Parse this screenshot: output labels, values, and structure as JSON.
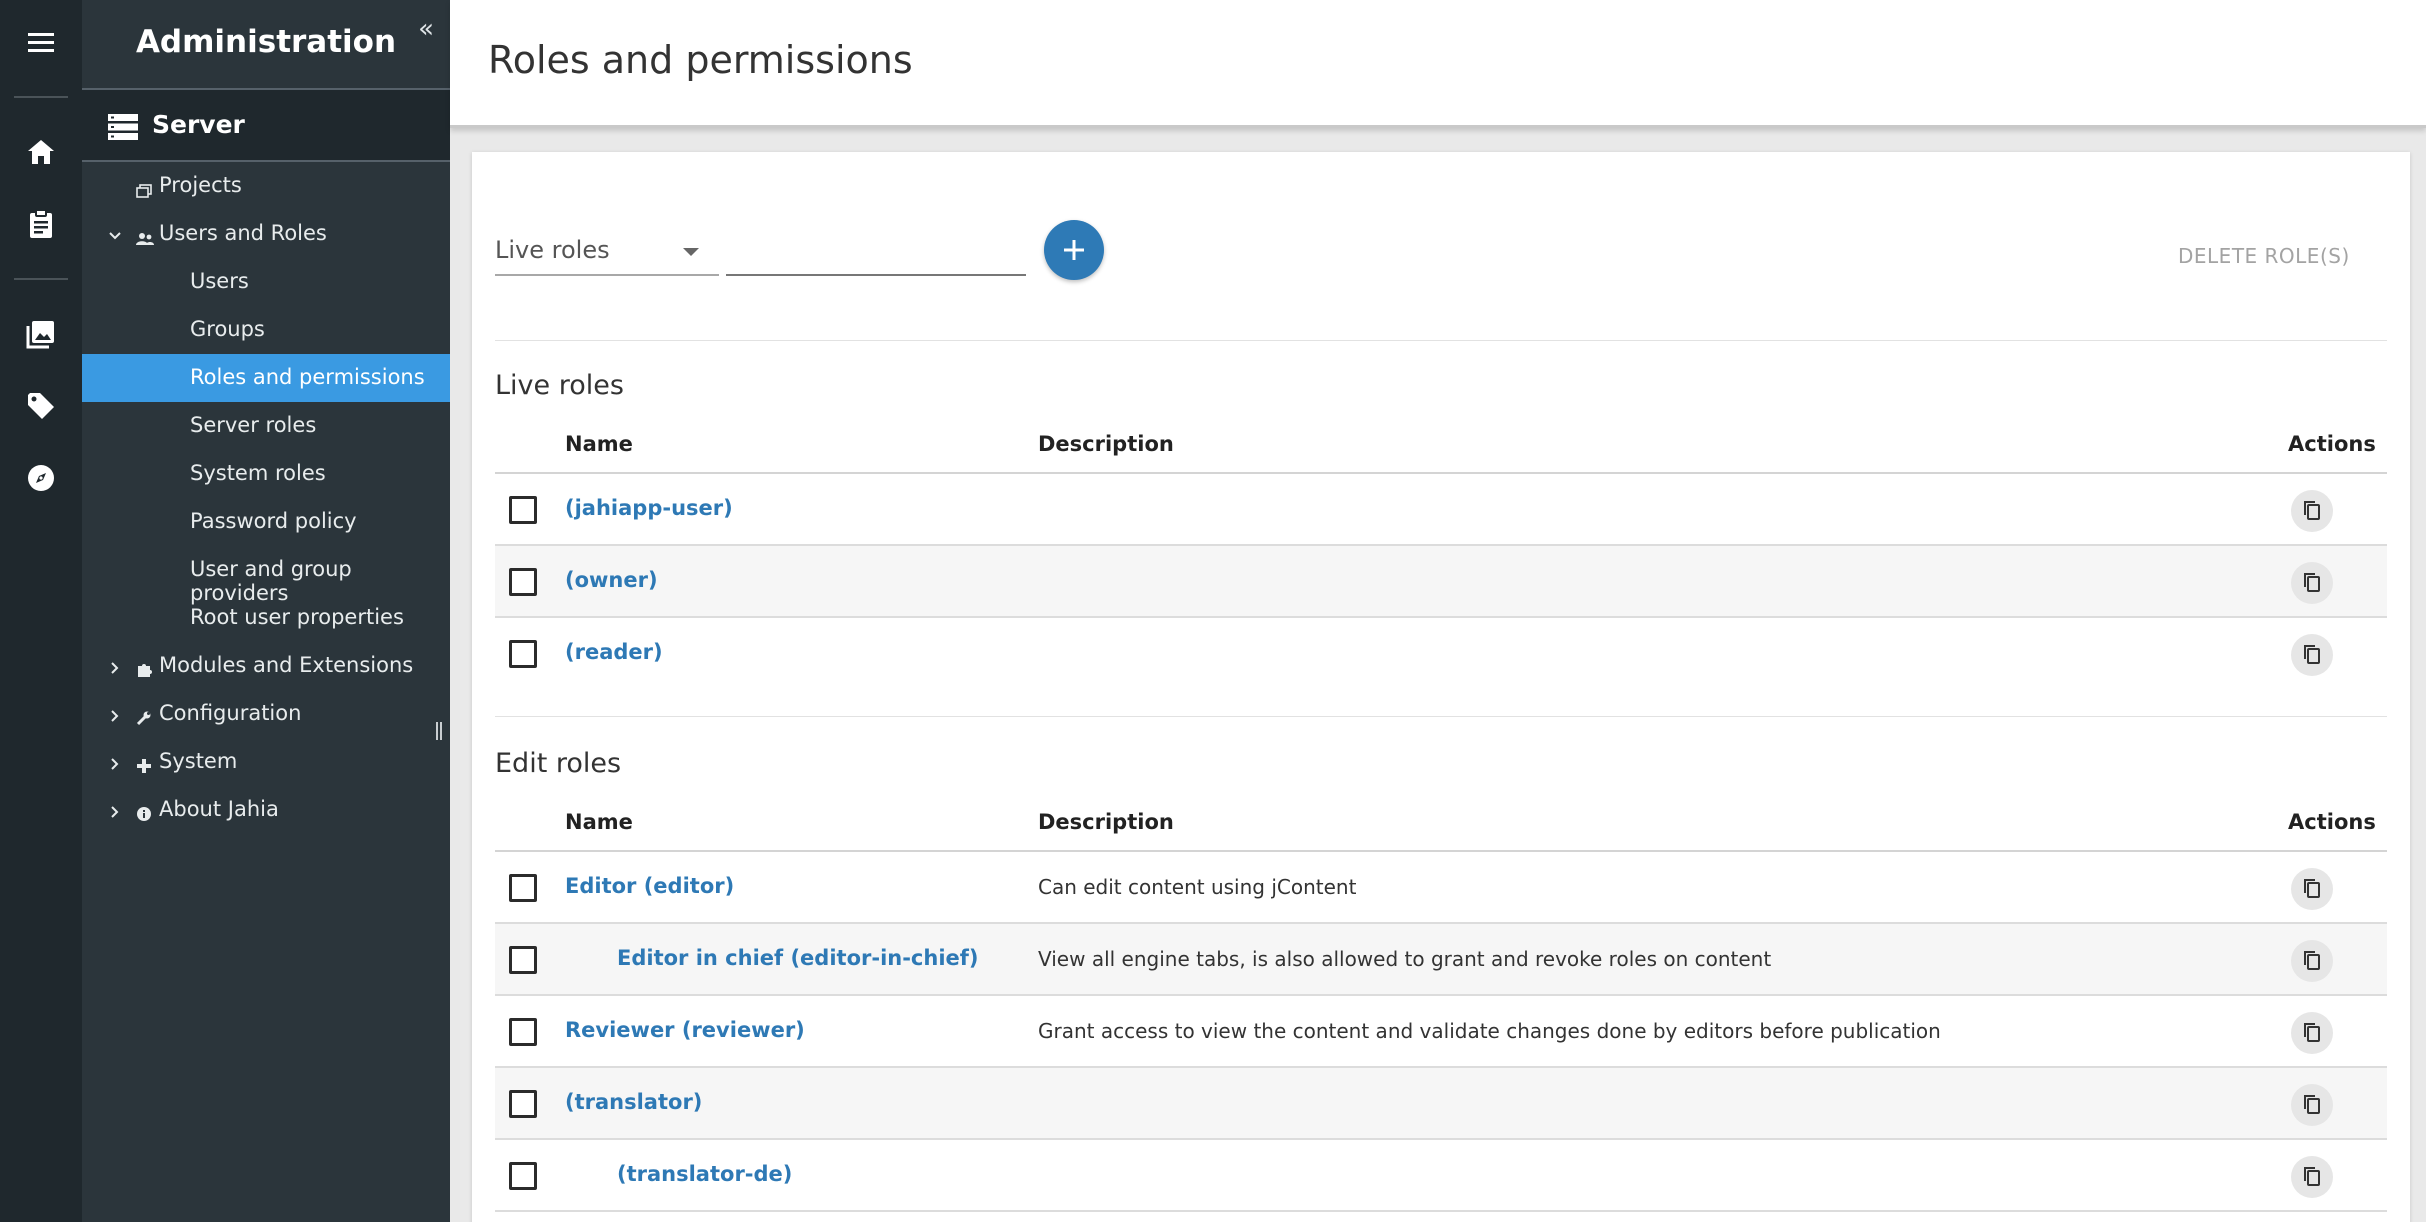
{
  "rail": {
    "icons": [
      "menu-icon",
      "home-icon",
      "clipboard-icon",
      "image-icon",
      "tag-icon",
      "compass-icon"
    ]
  },
  "sidebar": {
    "title": "Administration",
    "collapse_label": "«",
    "server_label": "Server",
    "items": [
      {
        "label": "Projects"
      },
      {
        "label": "Users and Roles"
      },
      {
        "label": "Users"
      },
      {
        "label": "Groups"
      },
      {
        "label": "Roles and permissions"
      },
      {
        "label": "Server roles"
      },
      {
        "label": "System roles"
      },
      {
        "label": "Password policy"
      },
      {
        "label": "User and group providers"
      },
      {
        "label": "Root user properties"
      },
      {
        "label": "Modules and Extensions"
      },
      {
        "label": "Configuration"
      },
      {
        "label": "System"
      },
      {
        "label": "About Jahia"
      }
    ],
    "active_color": "#3a9ae2"
  },
  "header": {
    "title": "Roles and permissions"
  },
  "toolbar": {
    "role_type": "Live roles",
    "search_value": "",
    "add_label": "+",
    "delete_label": "DELETE ROLE(S)"
  },
  "live_roles": {
    "title": "Live roles",
    "columns": {
      "name": "Name",
      "description": "Description",
      "actions": "Actions"
    },
    "rows": [
      {
        "name": "(jahiapp-user)",
        "description": ""
      },
      {
        "name": "(owner)",
        "description": ""
      },
      {
        "name": "(reader)",
        "description": ""
      }
    ]
  },
  "edit_roles": {
    "title": "Edit roles",
    "columns": {
      "name": "Name",
      "description": "Description",
      "actions": "Actions"
    },
    "rows": [
      {
        "name": "Editor (editor)",
        "description": "Can edit content using jContent"
      },
      {
        "name": "Editor in chief (editor-in-chief)",
        "description": "View all engine tabs, is also allowed to grant and revoke roles on content"
      },
      {
        "name": "Reviewer (reviewer)",
        "description": "Grant access to view the content and validate changes done by editors before publication"
      },
      {
        "name": "(translator)",
        "description": ""
      },
      {
        "name": "(translator-de)",
        "description": ""
      }
    ]
  },
  "colors": {
    "link": "#2e79b5",
    "accent": "#2e7ab6",
    "sidebar_bg": "#2b353b",
    "rail_bg": "#1f282d"
  }
}
